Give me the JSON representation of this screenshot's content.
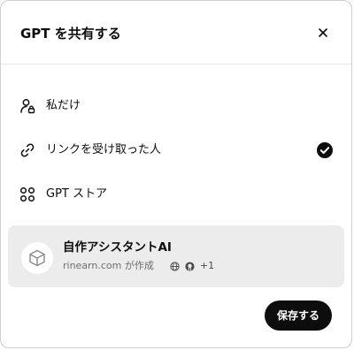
{
  "dialog": {
    "title": "GPT を共有する"
  },
  "options": [
    {
      "label": "私だけ",
      "icon": "user-lock-icon",
      "selected": false
    },
    {
      "label": "リンクを受け取った人",
      "icon": "link-icon",
      "selected": true
    },
    {
      "label": "GPT ストア",
      "icon": "grid-icon",
      "selected": false
    }
  ],
  "gpt": {
    "name": "自作アシスタントAI",
    "creator": "rinearn.com が作成",
    "extra_count": "+1"
  },
  "save_label": "保存する",
  "colors": {
    "accent": "#0d0d0d",
    "card_bg": "#ececec"
  }
}
